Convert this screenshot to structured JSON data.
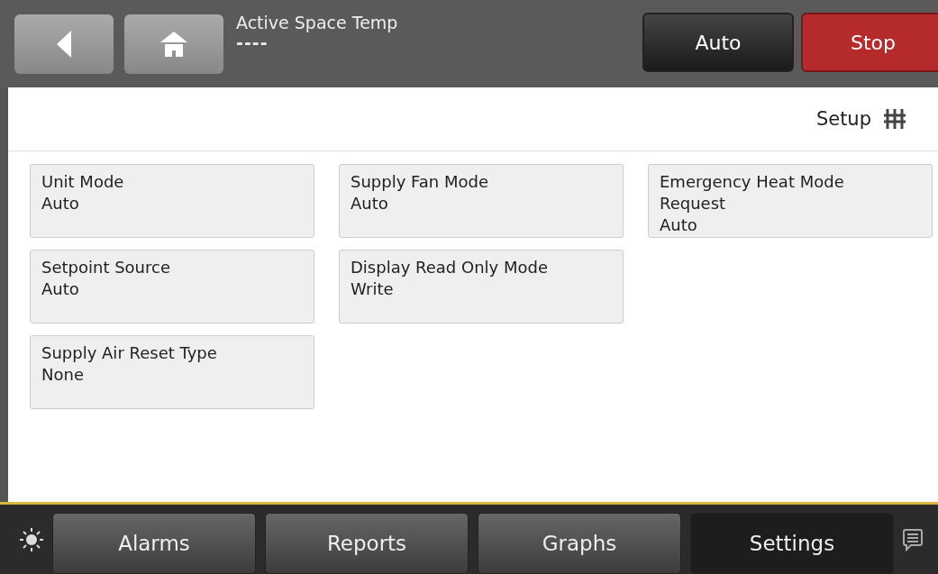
{
  "header": {
    "label": "Active Space Temp",
    "value": "----",
    "buttons": [
      {
        "label": "Auto",
        "kind": "dark"
      },
      {
        "label": "Stop",
        "kind": "stop"
      }
    ]
  },
  "panel": {
    "title": "Setup",
    "columns": [
      {
        "tiles": [
          {
            "label": "Unit Mode",
            "value": "Auto"
          },
          {
            "label": "Setpoint Source",
            "value": "Auto"
          },
          {
            "label": "Supply Air Reset Type",
            "value": "None"
          }
        ]
      },
      {
        "tiles": [
          {
            "label": "Supply Fan Mode",
            "value": "Auto"
          },
          {
            "label": "Display Read Only Mode",
            "value": "Write"
          }
        ]
      },
      {
        "tiles": [
          {
            "label": "Emergency Heat Mode Request",
            "value": "Auto"
          }
        ]
      }
    ]
  },
  "tabs": [
    {
      "label": "Alarms",
      "selected": false
    },
    {
      "label": "Reports",
      "selected": false
    },
    {
      "label": "Graphs",
      "selected": false
    },
    {
      "label": "Settings",
      "selected": true
    }
  ]
}
